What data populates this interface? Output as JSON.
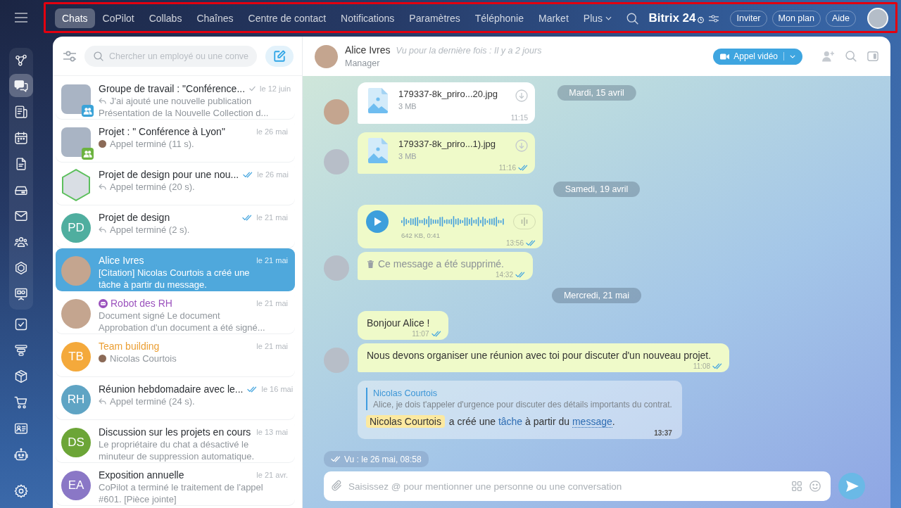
{
  "top_bar": {
    "highlighted": true,
    "tabs": [
      {
        "label": "Chats",
        "selected": true,
        "kind": "tab"
      },
      {
        "label": "CoPilot",
        "selected": false,
        "kind": "tab"
      },
      {
        "label": "Collabs",
        "selected": false,
        "kind": "tab"
      },
      {
        "label": "Chaînes",
        "selected": false,
        "kind": "tab"
      },
      {
        "label": "Centre de contact",
        "selected": false,
        "kind": "tab"
      },
      {
        "label": "Notifications",
        "selected": false,
        "kind": "tab"
      },
      {
        "label": "Paramètres",
        "selected": false,
        "kind": "tab"
      },
      {
        "label": "Téléphonie",
        "selected": false,
        "kind": "tab"
      },
      {
        "label": "Market",
        "selected": false,
        "kind": "tab"
      },
      {
        "label": "Plus",
        "selected": false,
        "kind": "menu"
      }
    ],
    "brand": "Bitrix 24",
    "buttons": [
      "Inviter",
      "Mon plan",
      "Aide"
    ]
  },
  "rail": {
    "pinned": [
      {
        "selected": false
      },
      {
        "selected": true
      },
      {
        "selected": false
      },
      {
        "selected": false
      },
      {
        "selected": false
      },
      {
        "selected": false
      },
      {
        "selected": false
      },
      {
        "selected": false
      },
      {
        "selected": false
      },
      {
        "selected": false
      }
    ],
    "items": [
      {
        "selected": false
      },
      {
        "selected": false
      },
      {
        "selected": false
      },
      {
        "selected": false
      },
      {
        "selected": false
      },
      {
        "selected": false
      }
    ]
  },
  "chat_list": {
    "search": {
      "placeholder": "Chercher un employé ou une conve"
    },
    "chats": [
      {
        "title": "Groupe de travail : \"Conférence...",
        "date": "le 12 juin",
        "sent": true,
        "read": false,
        "kind": "chat",
        "outgoing": true,
        "sender_avatar": false,
        "preview": [
          "J'ai ajouté une nouvelle publication",
          "Présentation de la Nouvelle Collection d..."
        ],
        "avatar": {
          "kind": "tile",
          "badge": {
            "color": "#3aa3d8"
          }
        },
        "selected": false
      },
      {
        "title": "Projet : \" Conférence à Lyon\"",
        "date": "le 26 mai",
        "sent": false,
        "read": false,
        "kind": "chat",
        "outgoing": false,
        "sender_avatar": true,
        "preview": [
          "Appel terminé (11 s)."
        ],
        "avatar": {
          "kind": "tile",
          "badge": {
            "color": "#6cb33f"
          }
        },
        "selected": false
      },
      {
        "title": "Projet de design pour une nou...",
        "date": "le 26 mai",
        "sent": true,
        "read": true,
        "kind": "chat",
        "outgoing": true,
        "sender_avatar": false,
        "preview": [
          "Appel terminé (20 s)."
        ],
        "avatar": {
          "kind": "hexagon"
        },
        "selected": false
      },
      {
        "title": "Projet de design",
        "date": "le 21 mai",
        "sent": true,
        "read": true,
        "kind": "chat",
        "outgoing": true,
        "sender_avatar": false,
        "preview": [
          "Appel terminé (2 s)."
        ],
        "avatar": {
          "kind": "initials",
          "text": "PD",
          "color": "#4fae9f"
        },
        "selected": false
      },
      {
        "title": "Alice Ivres",
        "date": "le 21 mai",
        "sent": false,
        "read": false,
        "kind": "chat",
        "outgoing": false,
        "sender_avatar": false,
        "preview": [
          "[Citation] Nicolas Courtois a créé une tâche à partir du message."
        ],
        "avatar": {
          "kind": "round"
        },
        "selected": true
      },
      {
        "title": "Robot des RH",
        "color": "#9b52bd",
        "date": "le 21 mai",
        "sent": false,
        "read": false,
        "kind": "bot",
        "outgoing": false,
        "sender_avatar": false,
        "preview": [
          "Document signé Le document",
          "Approbation d'un document a été signé..."
        ],
        "avatar": {
          "kind": "round"
        },
        "selected": false
      },
      {
        "title": "Team building",
        "color": "#eb9f34",
        "date": "le 21 mai",
        "sent": false,
        "read": false,
        "kind": "chat",
        "outgoing": false,
        "sender_avatar": true,
        "preview": [
          "Nicolas Courtois"
        ],
        "avatar": {
          "kind": "initials",
          "text": "TB",
          "color": "#f4a93b"
        },
        "selected": false
      },
      {
        "title": "Réunion hebdomadaire avec le...",
        "date": "le 16 mai",
        "sent": true,
        "read": true,
        "kind": "chat",
        "outgoing": true,
        "sender_avatar": false,
        "preview": [
          "Appel terminé (24 s)."
        ],
        "avatar": {
          "kind": "initials",
          "text": "RH",
          "color": "#5fa4c4"
        },
        "selected": false
      },
      {
        "title": "Discussion sur les projets en cours",
        "date": "le 13 mai",
        "sent": false,
        "read": false,
        "kind": "chat",
        "outgoing": false,
        "sender_avatar": false,
        "preview": [
          "Le propriétaire du chat a désactivé le minuteur de suppression automatique."
        ],
        "avatar": {
          "kind": "initials",
          "text": "DS",
          "color": "#6ca537"
        },
        "selected": false
      },
      {
        "title": "Exposition annuelle",
        "date": "le 21 avr.",
        "sent": false,
        "read": false,
        "kind": "chat",
        "outgoing": false,
        "sender_avatar": false,
        "preview": [
          "CoPilot a terminé le traitement de l'appel #601. [Pièce jointe]"
        ],
        "avatar": {
          "kind": "initials",
          "text": "EA",
          "color": "#8a77c6"
        },
        "selected": false
      }
    ]
  },
  "conversation": {
    "name": "Alice Ivres",
    "last_seen": "Vu pour la dernière fois : Il y a 2 jours",
    "role": "Manager",
    "call_button": "Appel vidéo",
    "sticky_date": "Mardi, 15 avril",
    "messages": [
      {
        "kind": "file",
        "outgoing": false,
        "avatar": true,
        "name": "179337-8k_priro...20.jpg",
        "size": "3 MB",
        "time": "11:15",
        "read": false
      },
      {
        "kind": "file",
        "outgoing": true,
        "avatar": true,
        "name": "179337-8k_priro...1).jpg",
        "size": "3 MB",
        "time": "11:16",
        "read": true
      },
      {
        "kind": "date",
        "text": "Samedi, 19 avril"
      },
      {
        "kind": "audio",
        "outgoing": true,
        "avatar": false,
        "info": "642 KB, 0:41",
        "time": "13:56",
        "read": true
      },
      {
        "kind": "deleted",
        "outgoing": true,
        "avatar": true,
        "text": "Ce message a été supprimé.",
        "time": "14:32",
        "read": true
      },
      {
        "kind": "date",
        "text": "Mercredi, 21 mai"
      },
      {
        "kind": "text",
        "outgoing": true,
        "avatar": false,
        "text": "Bonjour Alice !",
        "time": "11:07",
        "read": true
      },
      {
        "kind": "text",
        "outgoing": true,
        "avatar": true,
        "text": "Nous devons organiser une réunion avec toi pour discuter d'un nouveau projet.",
        "time": "11:08",
        "read": true
      },
      {
        "kind": "system",
        "avatar": false,
        "quote": {
          "author": "Nicolas Courtois",
          "text": "Alice, je dois t'appeler d'urgence pour discuter des détails importants du contrat."
        },
        "parts": [
          {
            "kind": "mention",
            "text": "Nicolas Courtois"
          },
          {
            "kind": "text",
            "text": " a créé une "
          },
          {
            "kind": "link",
            "text": "tâche",
            "dotted": false
          },
          {
            "kind": "text",
            "text": " à partir du "
          },
          {
            "kind": "link",
            "text": "message",
            "dotted": true
          },
          {
            "kind": "text",
            "text": "."
          }
        ],
        "time": "13:37",
        "read": false
      }
    ],
    "seen": "Vu : le 26 mai, 08:58",
    "composer": {
      "placeholder": "Saisissez @ pour mentionner une personne ou une conversation"
    }
  }
}
